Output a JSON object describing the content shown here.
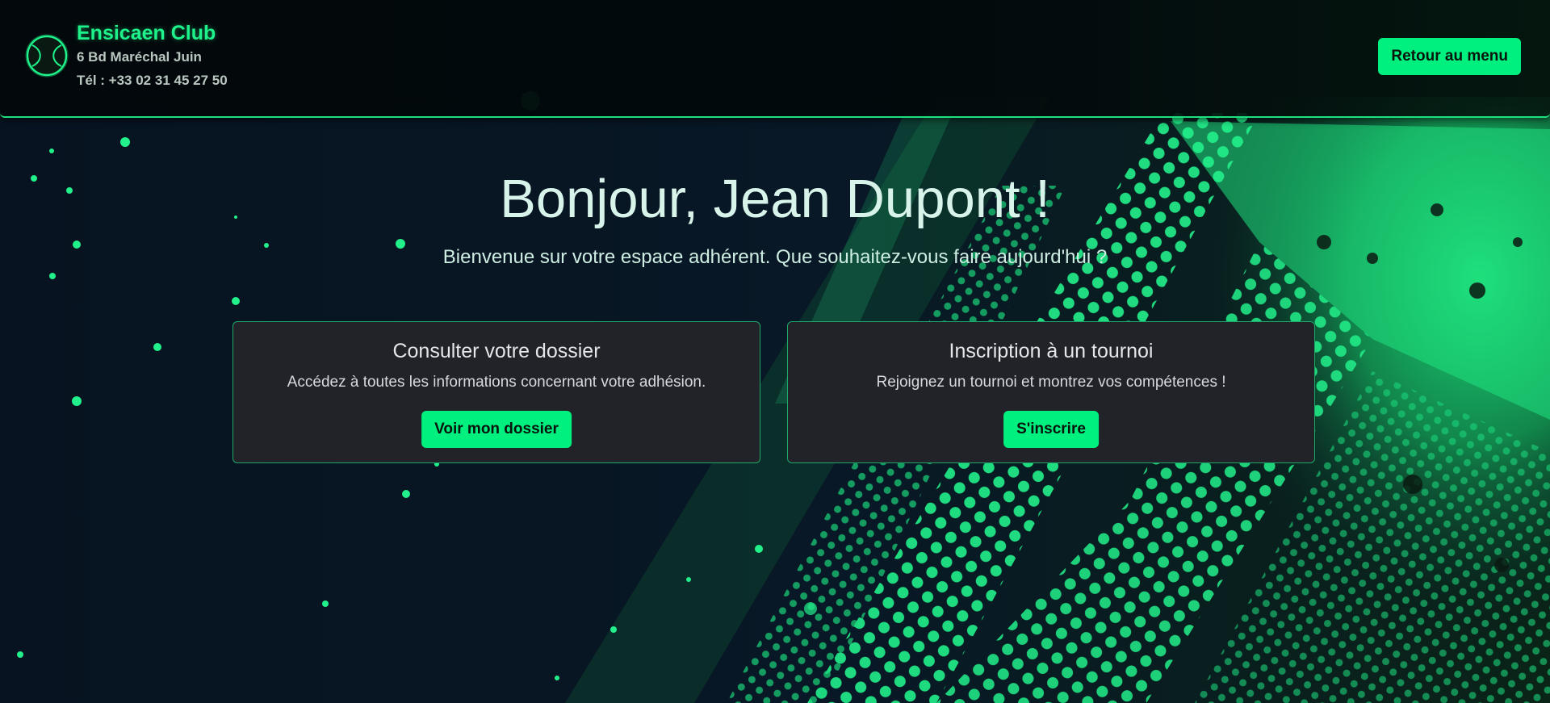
{
  "header": {
    "club_name": "Ensicaen Club",
    "address": "6 Bd Maréchal Juin",
    "phone": "Tél : +33 02 31 45 27 50",
    "menu_button": "Retour au menu",
    "logo_icon": "tennis-ball-icon"
  },
  "hero": {
    "title": "Bonjour, Jean Dupont !",
    "subtitle": "Bienvenue sur votre espace adhérent. Que souhaitez-vous faire aujourd'hui ?"
  },
  "cards": [
    {
      "title": "Consulter votre dossier",
      "text": "Accédez à toutes les informations concernant votre adhésion.",
      "button": "Voir mon dossier"
    },
    {
      "title": "Inscription à un tournoi",
      "text": "Rejoignez un tournoi et montrez vos compétences !",
      "button": "S'inscrire"
    }
  ],
  "colors": {
    "accent": "#00f07f",
    "background": "#06101c",
    "card": "#212328"
  }
}
